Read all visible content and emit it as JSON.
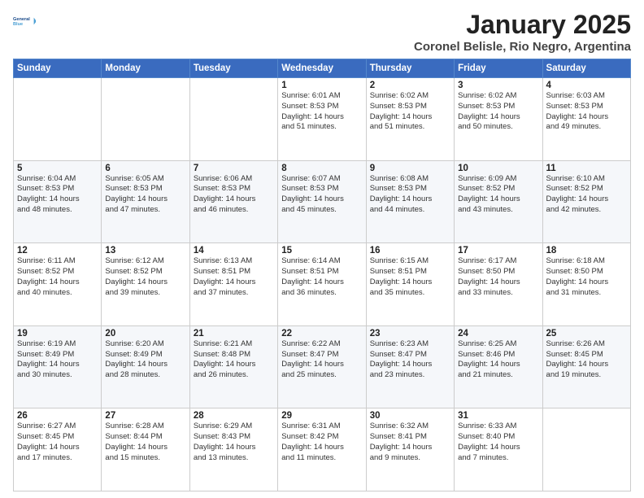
{
  "header": {
    "logo_line1": "General",
    "logo_line2": "Blue",
    "month": "January 2025",
    "location": "Coronel Belisle, Rio Negro, Argentina"
  },
  "days_of_week": [
    "Sunday",
    "Monday",
    "Tuesday",
    "Wednesday",
    "Thursday",
    "Friday",
    "Saturday"
  ],
  "weeks": [
    [
      {
        "day": "",
        "info": ""
      },
      {
        "day": "",
        "info": ""
      },
      {
        "day": "",
        "info": ""
      },
      {
        "day": "1",
        "info": "Sunrise: 6:01 AM\nSunset: 8:53 PM\nDaylight: 14 hours\nand 51 minutes."
      },
      {
        "day": "2",
        "info": "Sunrise: 6:02 AM\nSunset: 8:53 PM\nDaylight: 14 hours\nand 51 minutes."
      },
      {
        "day": "3",
        "info": "Sunrise: 6:02 AM\nSunset: 8:53 PM\nDaylight: 14 hours\nand 50 minutes."
      },
      {
        "day": "4",
        "info": "Sunrise: 6:03 AM\nSunset: 8:53 PM\nDaylight: 14 hours\nand 49 minutes."
      }
    ],
    [
      {
        "day": "5",
        "info": "Sunrise: 6:04 AM\nSunset: 8:53 PM\nDaylight: 14 hours\nand 48 minutes."
      },
      {
        "day": "6",
        "info": "Sunrise: 6:05 AM\nSunset: 8:53 PM\nDaylight: 14 hours\nand 47 minutes."
      },
      {
        "day": "7",
        "info": "Sunrise: 6:06 AM\nSunset: 8:53 PM\nDaylight: 14 hours\nand 46 minutes."
      },
      {
        "day": "8",
        "info": "Sunrise: 6:07 AM\nSunset: 8:53 PM\nDaylight: 14 hours\nand 45 minutes."
      },
      {
        "day": "9",
        "info": "Sunrise: 6:08 AM\nSunset: 8:53 PM\nDaylight: 14 hours\nand 44 minutes."
      },
      {
        "day": "10",
        "info": "Sunrise: 6:09 AM\nSunset: 8:52 PM\nDaylight: 14 hours\nand 43 minutes."
      },
      {
        "day": "11",
        "info": "Sunrise: 6:10 AM\nSunset: 8:52 PM\nDaylight: 14 hours\nand 42 minutes."
      }
    ],
    [
      {
        "day": "12",
        "info": "Sunrise: 6:11 AM\nSunset: 8:52 PM\nDaylight: 14 hours\nand 40 minutes."
      },
      {
        "day": "13",
        "info": "Sunrise: 6:12 AM\nSunset: 8:52 PM\nDaylight: 14 hours\nand 39 minutes."
      },
      {
        "day": "14",
        "info": "Sunrise: 6:13 AM\nSunset: 8:51 PM\nDaylight: 14 hours\nand 37 minutes."
      },
      {
        "day": "15",
        "info": "Sunrise: 6:14 AM\nSunset: 8:51 PM\nDaylight: 14 hours\nand 36 minutes."
      },
      {
        "day": "16",
        "info": "Sunrise: 6:15 AM\nSunset: 8:51 PM\nDaylight: 14 hours\nand 35 minutes."
      },
      {
        "day": "17",
        "info": "Sunrise: 6:17 AM\nSunset: 8:50 PM\nDaylight: 14 hours\nand 33 minutes."
      },
      {
        "day": "18",
        "info": "Sunrise: 6:18 AM\nSunset: 8:50 PM\nDaylight: 14 hours\nand 31 minutes."
      }
    ],
    [
      {
        "day": "19",
        "info": "Sunrise: 6:19 AM\nSunset: 8:49 PM\nDaylight: 14 hours\nand 30 minutes."
      },
      {
        "day": "20",
        "info": "Sunrise: 6:20 AM\nSunset: 8:49 PM\nDaylight: 14 hours\nand 28 minutes."
      },
      {
        "day": "21",
        "info": "Sunrise: 6:21 AM\nSunset: 8:48 PM\nDaylight: 14 hours\nand 26 minutes."
      },
      {
        "day": "22",
        "info": "Sunrise: 6:22 AM\nSunset: 8:47 PM\nDaylight: 14 hours\nand 25 minutes."
      },
      {
        "day": "23",
        "info": "Sunrise: 6:23 AM\nSunset: 8:47 PM\nDaylight: 14 hours\nand 23 minutes."
      },
      {
        "day": "24",
        "info": "Sunrise: 6:25 AM\nSunset: 8:46 PM\nDaylight: 14 hours\nand 21 minutes."
      },
      {
        "day": "25",
        "info": "Sunrise: 6:26 AM\nSunset: 8:45 PM\nDaylight: 14 hours\nand 19 minutes."
      }
    ],
    [
      {
        "day": "26",
        "info": "Sunrise: 6:27 AM\nSunset: 8:45 PM\nDaylight: 14 hours\nand 17 minutes."
      },
      {
        "day": "27",
        "info": "Sunrise: 6:28 AM\nSunset: 8:44 PM\nDaylight: 14 hours\nand 15 minutes."
      },
      {
        "day": "28",
        "info": "Sunrise: 6:29 AM\nSunset: 8:43 PM\nDaylight: 14 hours\nand 13 minutes."
      },
      {
        "day": "29",
        "info": "Sunrise: 6:31 AM\nSunset: 8:42 PM\nDaylight: 14 hours\nand 11 minutes."
      },
      {
        "day": "30",
        "info": "Sunrise: 6:32 AM\nSunset: 8:41 PM\nDaylight: 14 hours\nand 9 minutes."
      },
      {
        "day": "31",
        "info": "Sunrise: 6:33 AM\nSunset: 8:40 PM\nDaylight: 14 hours\nand 7 minutes."
      },
      {
        "day": "",
        "info": ""
      }
    ]
  ]
}
